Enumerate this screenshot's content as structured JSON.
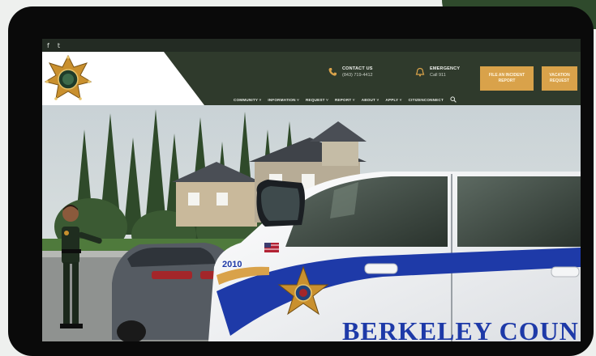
{
  "social": {
    "facebook_icon": "f",
    "twitter_icon": "t"
  },
  "header": {
    "logo": {
      "name": "sheriff-star-badge",
      "color": "#c9902e"
    },
    "contact": {
      "title": "CONTACT US",
      "phone": "(843) 719-4412"
    },
    "emergency": {
      "title": "EMERGENCY",
      "sub": "Call 911"
    },
    "report_button": "FILE AN INCIDENT REPORT",
    "vacation_button": "VACATION REQUEST"
  },
  "nav": {
    "items": [
      "COMMUNITY ˅",
      "INFORMATION ˅",
      "REQUEST ˅",
      "REPORT ˅",
      "ABOUT ˅",
      "APPLY ˅",
      "CITIZENCONNECT"
    ]
  },
  "hero": {
    "vehicle_text": "BERKELEY COUN",
    "unit_number": "2010"
  },
  "colors": {
    "header_bg": "#2f3a2c",
    "accent_gold": "#d9a24a",
    "vehicle_stripe": "#1e3aa8",
    "frame_green": "#2f4a2c"
  }
}
